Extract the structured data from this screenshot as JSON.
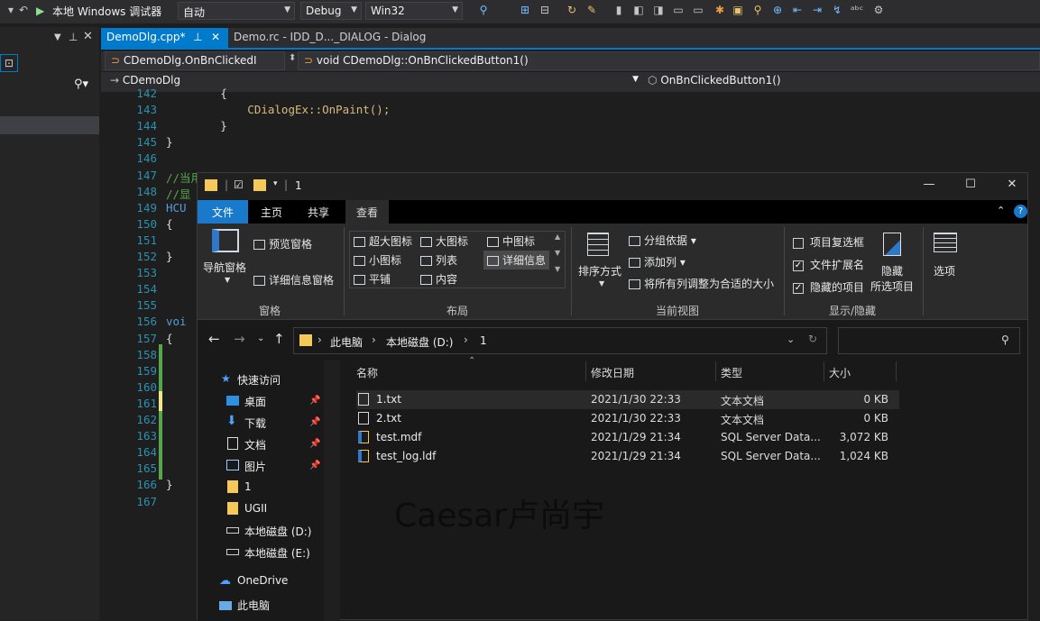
{
  "vs": {
    "toolbar": {
      "run_label": "本地 Windows 调试器",
      "config_combo": "自动",
      "build_combo": "Debug",
      "platform_combo": "Win32"
    },
    "tabs": [
      {
        "label": "DemoDlg.cpp*",
        "pin": "⊥",
        "close": "✕"
      },
      {
        "label": "Demo.rc - IDD_D..._DIALOG - Dialog"
      }
    ],
    "nav": {
      "scope_combo": "CDemoDlg.OnBnClickedI",
      "member_combo": "void CDemoDlg::OnBnClickedButton1()",
      "class_combo": "CDemoDlg",
      "function_combo": "OnBnClickedButton1()"
    },
    "code_lines": [
      {
        "num": "142",
        "text": "        {"
      },
      {
        "num": "143",
        "text": "            CDialogEx::OnPaint();"
      },
      {
        "num": "144",
        "text": "        }"
      },
      {
        "num": "145",
        "text": "}"
      },
      {
        "num": "146",
        "text": ""
      },
      {
        "num": "147",
        "text": "//当用户拖动最小化窗口时系统调用此函数取得光标"
      },
      {
        "num": "148",
        "text": "//显"
      },
      {
        "num": "149",
        "text": "HCU"
      },
      {
        "num": "150",
        "text": "{"
      },
      {
        "num": "151",
        "text": ""
      },
      {
        "num": "152",
        "text": "}"
      },
      {
        "num": "153",
        "text": ""
      },
      {
        "num": "154",
        "text": ""
      },
      {
        "num": "155",
        "text": ""
      },
      {
        "num": "156",
        "text": "voi"
      },
      {
        "num": "157",
        "text": "{"
      },
      {
        "num": "158",
        "text": ""
      },
      {
        "num": "159",
        "text": ""
      },
      {
        "num": "160",
        "text": ""
      },
      {
        "num": "161",
        "text": ""
      },
      {
        "num": "162",
        "text": ""
      },
      {
        "num": "163",
        "text": ""
      },
      {
        "num": "164",
        "text": ""
      },
      {
        "num": "165",
        "text": ""
      },
      {
        "num": "166",
        "text": "}"
      },
      {
        "num": "167",
        "text": ""
      }
    ]
  },
  "explorer": {
    "title": "1",
    "ribbon_tabs": [
      "文件",
      "主页",
      "共享",
      "查看"
    ],
    "ribbon": {
      "panes": {
        "nav_pane": "导航窗格",
        "preview_pane": "预览窗格",
        "details_pane": "详细信息窗格",
        "group_title": "窗格"
      },
      "layout": {
        "items": [
          "超大图标",
          "大图标",
          "中图标",
          "小图标",
          "列表",
          "详细信息",
          "平铺",
          "内容"
        ],
        "group_title": "布局"
      },
      "current_view": {
        "sort_by": "排序方式",
        "group_by": "分组依据",
        "add_column": "添加列",
        "fit_columns": "将所有列调整为合适的大小",
        "group_title": "当前视图"
      },
      "show_hide": {
        "item_checkboxes": "项目复选框",
        "file_extensions": "文件扩展名",
        "hidden_items": "隐藏的项目",
        "hide_selected_1": "隐藏",
        "hide_selected_2": "所选项目",
        "options": "选项",
        "group_title": "显示/隐藏"
      }
    },
    "address": [
      "此电脑",
      "本地磁盘 (D:)",
      "1"
    ],
    "sidebar": {
      "quick_access": "快速访问",
      "items": [
        "桌面",
        "下载",
        "文档",
        "图片",
        "1",
        "UGII",
        "本地磁盘 (D:)",
        "本地磁盘 (E:)"
      ],
      "onedrive": "OneDrive",
      "this_pc": "此电脑"
    },
    "columns": {
      "name": "名称",
      "date": "修改日期",
      "type": "类型",
      "size": "大小"
    },
    "files": [
      {
        "name": "1.txt",
        "date": "2021/1/30 22:33",
        "type": "文本文档",
        "size": "0 KB"
      },
      {
        "name": "2.txt",
        "date": "2021/1/30 22:33",
        "type": "文本文档",
        "size": "0 KB"
      },
      {
        "name": "test.mdf",
        "date": "2021/1/29 21:34",
        "type": "SQL Server Data...",
        "size": "3,072 KB"
      },
      {
        "name": "test_log.ldf",
        "date": "2021/1/29 21:34",
        "type": "SQL Server Data...",
        "size": "1,024 KB"
      }
    ]
  },
  "watermark": "Caesar卢尚宇",
  "colors": {
    "accent": "#007acc",
    "file_tab": "#1979ca",
    "line_number": "#2b91af",
    "change_bar": "#57a64a"
  }
}
